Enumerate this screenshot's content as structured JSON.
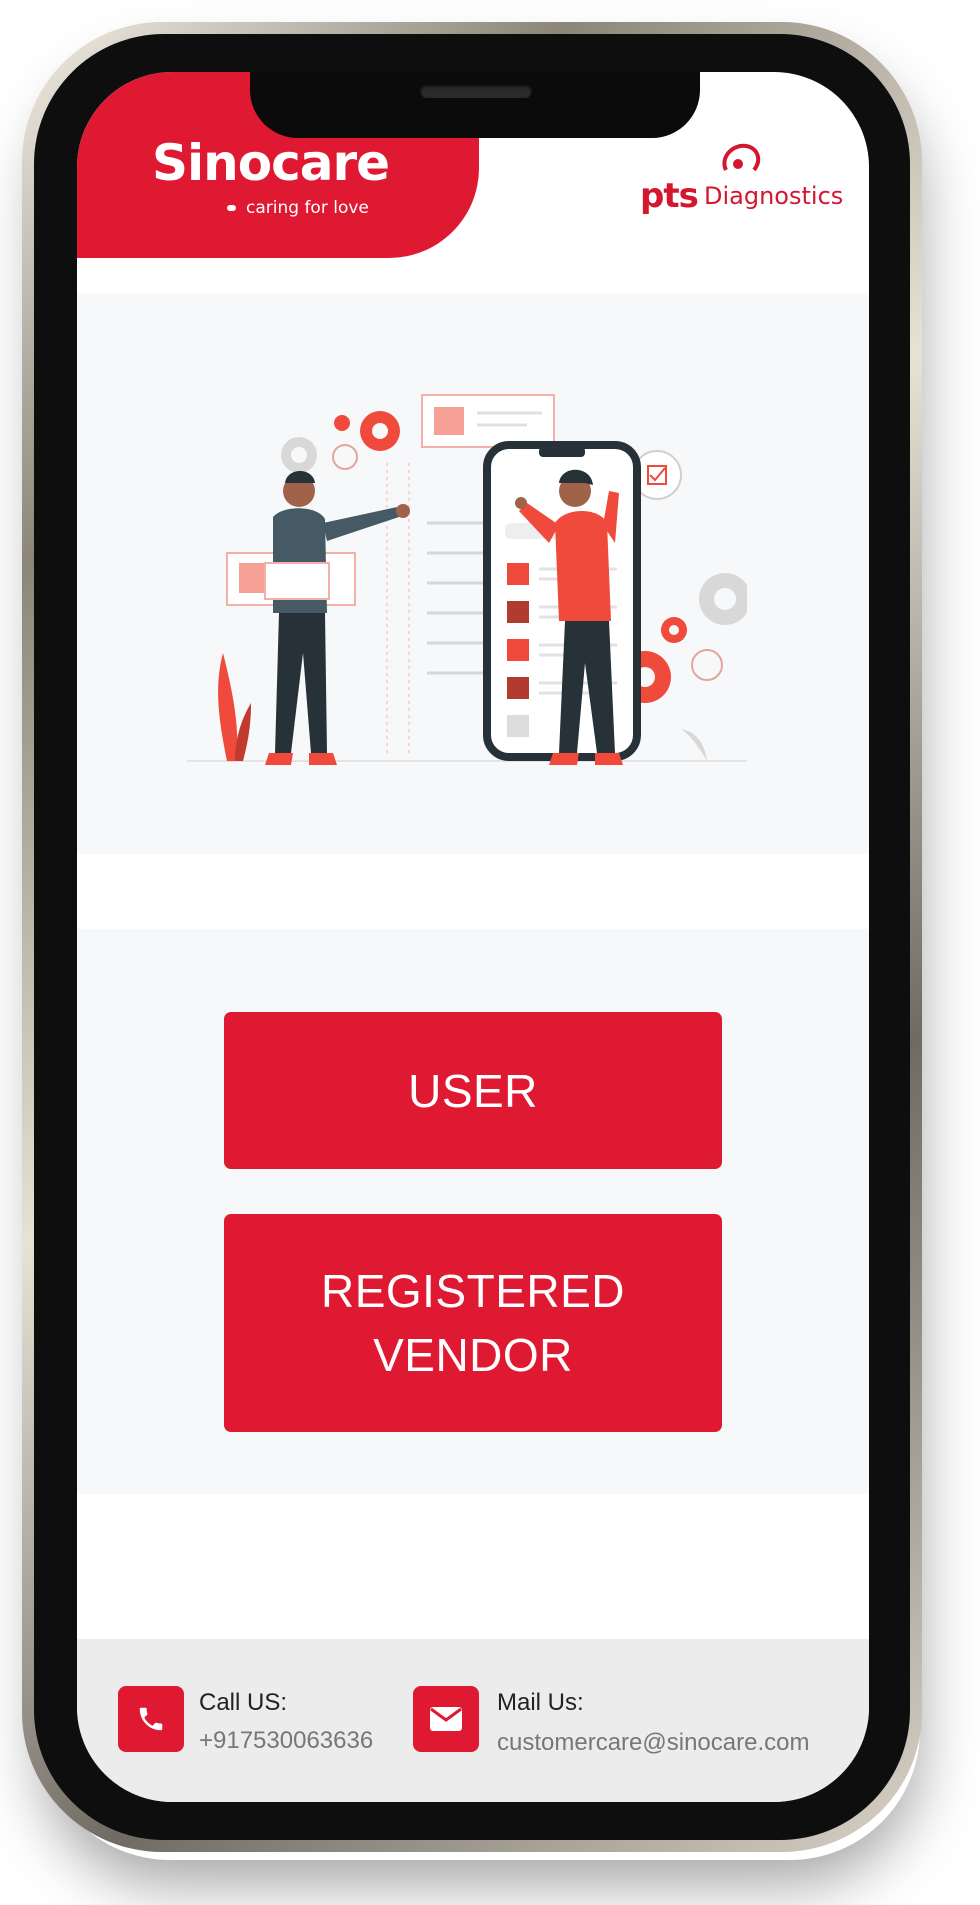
{
  "header": {
    "brand_name": "Sinocare",
    "brand_tagline": "caring for love",
    "partner_short": "pts",
    "partner_name": "Diagnostics",
    "brand_color": "#e01933"
  },
  "illustration": {
    "icon": "people-configuring-phone-illustration"
  },
  "actions": {
    "user_label": "USER",
    "vendor_label": "REGISTERED VENDOR"
  },
  "footer": {
    "call_label": "Call US:",
    "call_value": "+917530063636",
    "mail_label": "Mail Us:",
    "mail_value": "customercare@sinocare.com",
    "call_icon": "phone-icon",
    "mail_icon": "envelope-icon"
  }
}
